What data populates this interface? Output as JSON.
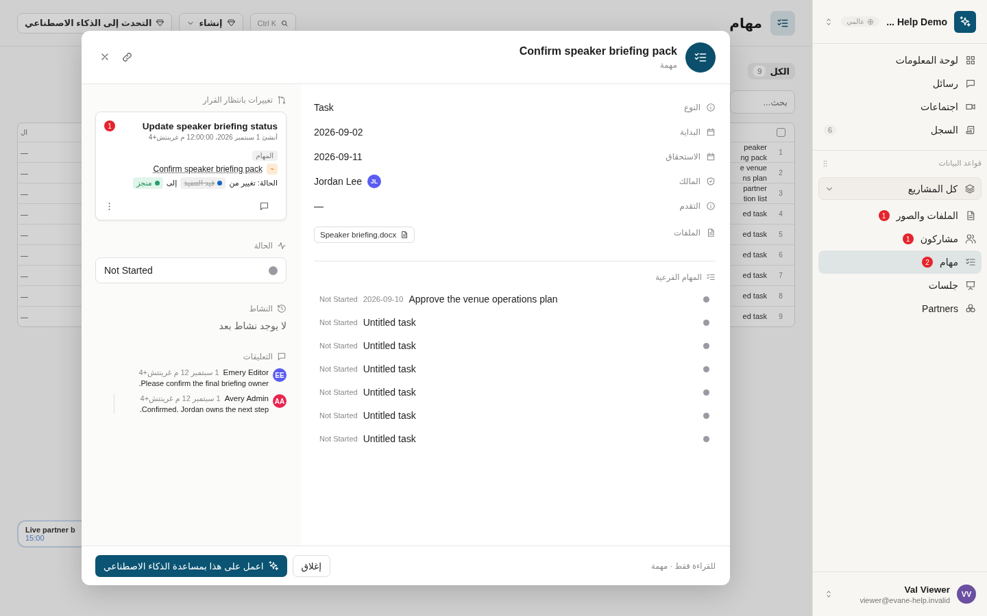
{
  "page": {
    "title": "مهام",
    "search_shortcut": "Ctrl K",
    "create_button": "إنشاء",
    "ai_button": "التحدث إلى الذكاء الاصطناعي",
    "tabs": [
      {
        "label": "الكل",
        "count": "9",
        "selected": true
      }
    ],
    "search": {
      "placeholder": "بحث..."
    },
    "table": {
      "select_all_checked": false,
      "column_3": "ال",
      "rows": [
        {
          "number": "1",
          "name": "peaker\nng pack",
          "column_3": "—"
        },
        {
          "number": "2",
          "name": "e venue\nns plan",
          "column_3": "—"
        },
        {
          "number": "3",
          "name": "partner\ntion list",
          "column_3": "—"
        },
        {
          "number": "4",
          "name": "ed task",
          "column_3": "—"
        },
        {
          "number": "5",
          "name": "ed task",
          "column_3": "—"
        },
        {
          "number": "6",
          "name": "ed task",
          "column_3": "—"
        },
        {
          "number": "7",
          "name": "ed task",
          "column_3": "—"
        },
        {
          "number": "8",
          "name": "ed task",
          "column_3": "—"
        },
        {
          "number": "9",
          "name": "ed task",
          "column_3": "—"
        }
      ]
    },
    "event": {
      "title": "Live partner b",
      "time": "15:00"
    }
  },
  "modal": {
    "title": "Confirm speaker briefing pack",
    "subtitle": "مهمة",
    "fields": [
      {
        "kind": "text",
        "label": "النوع",
        "value": "Task"
      },
      {
        "kind": "text",
        "label": "البداية",
        "value": "2026-09-02"
      },
      {
        "kind": "text",
        "label": "الاستحقاق",
        "value": "2026-09-11"
      },
      {
        "kind": "person",
        "label": "المالك",
        "value": "Jordan Lee",
        "initials": "JL"
      },
      {
        "kind": "text",
        "label": "التقدم",
        "value": "—"
      },
      {
        "kind": "file",
        "label": "الملفات",
        "value": "Speaker briefing.docx"
      }
    ],
    "subtasks_title": "المهام الفرعية",
    "subtasks": [
      {
        "status": "Not Started",
        "date": "2026-09-10",
        "title": "Approve the venue operations plan"
      },
      {
        "status": "Not Started",
        "title": "Untitled task"
      },
      {
        "status": "Not Started",
        "title": "Untitled task"
      },
      {
        "status": "Not Started",
        "title": "Untitled task"
      },
      {
        "status": "Not Started",
        "title": "Untitled task"
      },
      {
        "status": "Not Started",
        "title": "Untitled task"
      },
      {
        "status": "Not Started",
        "title": "Untitled task"
      }
    ],
    "pending": {
      "title": "تغييرات بانتظار القرار",
      "badge": "1",
      "card_title": "Update speaker briefing status",
      "created": "أنشئ 1 سبتمبر 2026، 12:00:00 م غرينتش+4",
      "tag": "المهام",
      "marker": "~",
      "link": "Confirm speaker briefing pack",
      "change_label": "الحالة: تغيير من",
      "from": {
        "label": "قيد التنفيذ",
        "color": "#1565c0"
      },
      "to_word": "إلى",
      "to": {
        "label": "منجز",
        "color": "#22a06b"
      }
    },
    "status": {
      "title": "الحالة",
      "value": "Not Started"
    },
    "activity": {
      "title": "النشاط",
      "empty": "لا يوجد نشاط بعد"
    },
    "comments": {
      "title": "التعليقات",
      "items": [
        {
          "initials": "EE",
          "color": "#5b5cf0",
          "author": "Emery Editor",
          "time": "1 سبتمبر 12 م غرينتش+4",
          "text": "Please confirm the final briefing owner.",
          "reply": false
        },
        {
          "initials": "AA",
          "color": "#e8244f",
          "author": "Avery Admin",
          "time": "1 سبتمبر 12 م غرينتش+4",
          "text": "Confirmed. Jordan owns the next step.",
          "reply": true
        }
      ]
    },
    "footer": {
      "note": "للقراءة فقط · مهمة",
      "close": "إغلاق",
      "ai_action": "اعمل على هذا بمساعدة الذكاء الاصطناعي"
    }
  },
  "sidebar": {
    "workspace": "Help Demo ...",
    "scope": "عالمي",
    "nav": [
      {
        "label": "لوحة المعلومات"
      },
      {
        "label": "رسائل"
      },
      {
        "label": "اجتماعات"
      },
      {
        "label": "السجل",
        "count": "6"
      }
    ],
    "section_title": "قواعد البيانات",
    "project_filter": "كل المشاريع",
    "databases": [
      {
        "label": "الملفات والصور",
        "badge": "1",
        "selected": false
      },
      {
        "label": "مشاركون",
        "badge": "1",
        "selected": false
      },
      {
        "label": "مهام",
        "badge": "2",
        "selected": true
      },
      {
        "label": "جلسات",
        "selected": false
      },
      {
        "label": "Partners",
        "selected": false
      }
    ],
    "user": {
      "initials": "VV",
      "name": "Val Viewer",
      "email": "viewer@evane-help.invalid"
    }
  }
}
